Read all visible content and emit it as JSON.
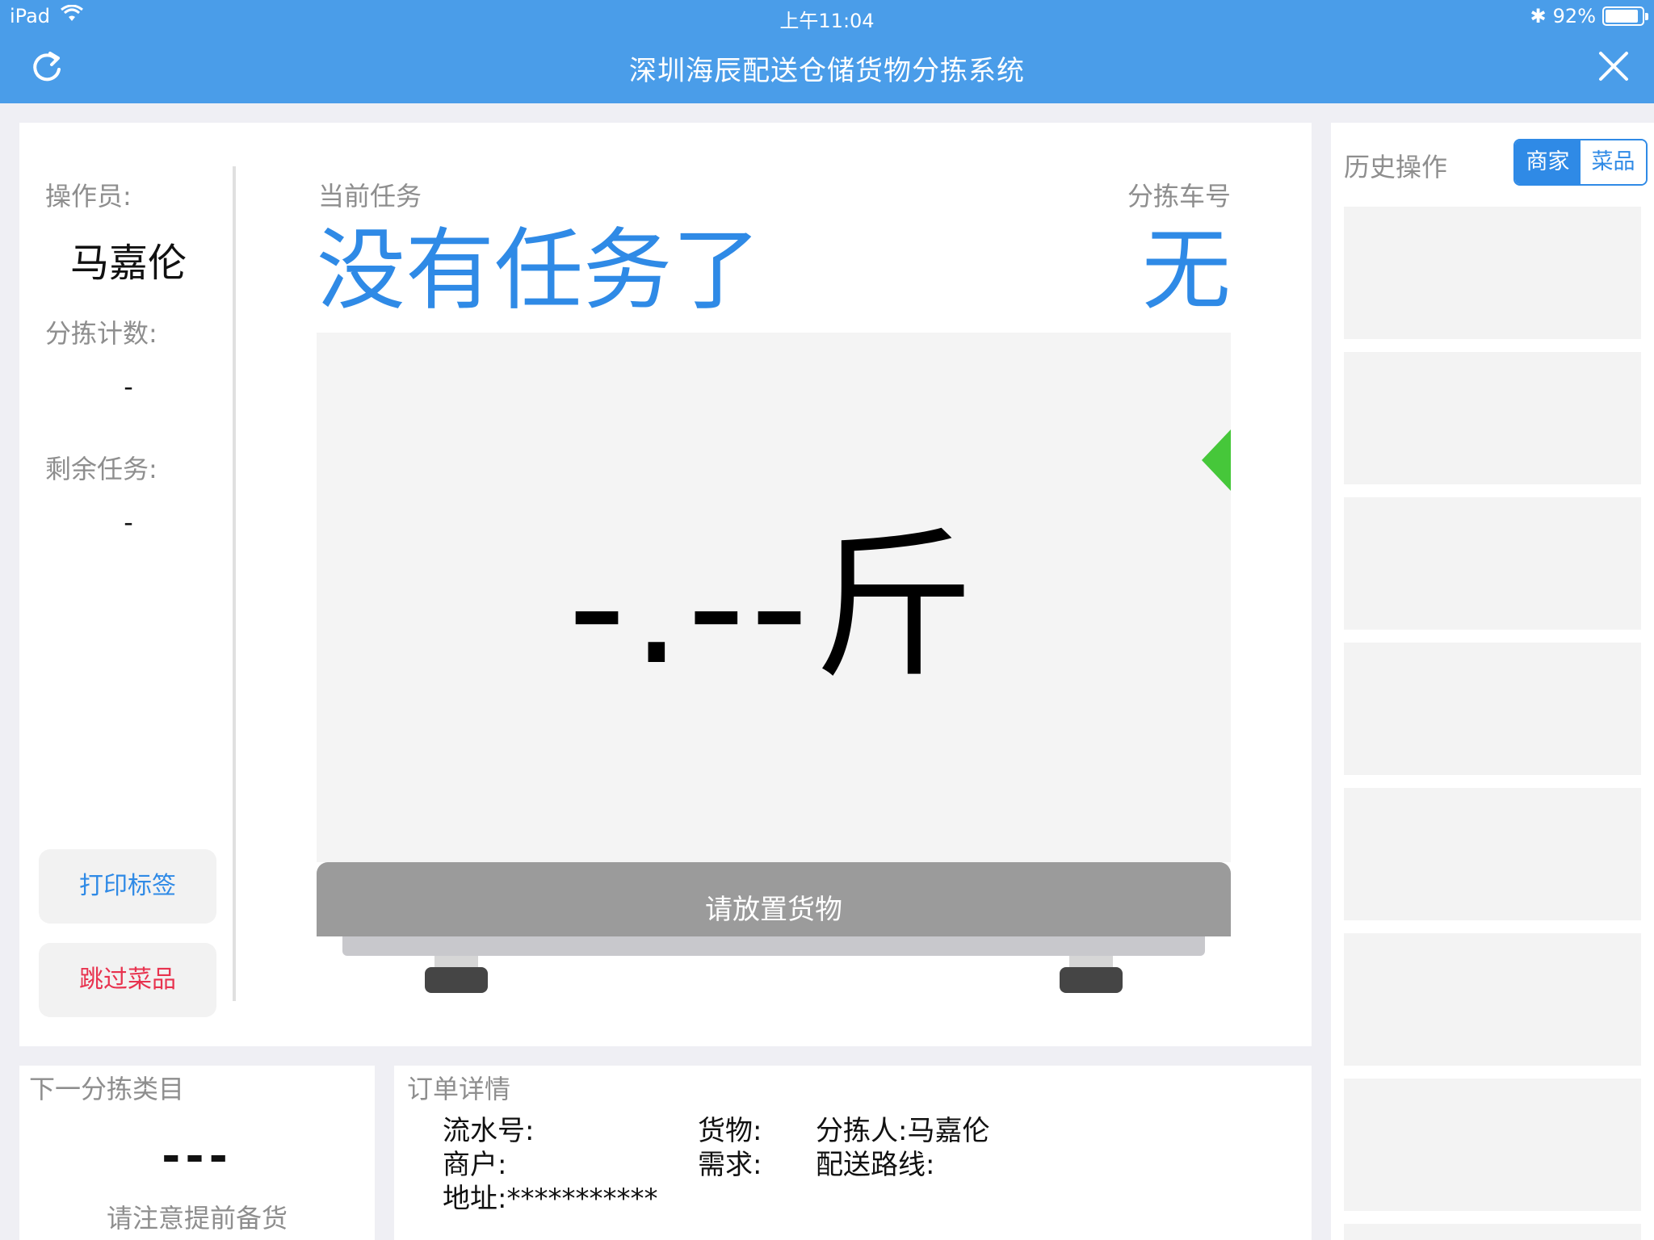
{
  "status_bar": {
    "device": "iPad",
    "time": "上午11:04",
    "battery": "92%",
    "battery_level": 0.92
  },
  "nav": {
    "title": "深圳海辰配送仓储货物分拣系统",
    "refresh_icon": "refresh-icon",
    "close_icon": "close-icon"
  },
  "sidebar": {
    "operator_label": "操作员:",
    "operator_value": "马嘉伦",
    "count_label": "分拣计数:",
    "count_value": "-",
    "remaining_label": "剩余任务:",
    "remaining_value": "-",
    "print_button": "打印标签",
    "skip_button": "跳过菜品"
  },
  "task": {
    "current_label": "当前任务",
    "current_value": "没有任务了",
    "cart_label": "分拣车号",
    "cart_value": "无"
  },
  "scale": {
    "weight": "-.--斤",
    "prompt": "请放置货物"
  },
  "history": {
    "title": "历史操作",
    "segments": [
      "商家",
      "菜品"
    ],
    "selected": "商家"
  },
  "next_category": {
    "title": "下一分拣类目",
    "value": "---",
    "note": "请注意提前备货"
  },
  "order": {
    "title": "订单详情",
    "serial": "流水号:",
    "merchant": "商户:",
    "address": "地址:***********",
    "goods": "货物:",
    "demand": "需求:",
    "sorter": "分拣人:马嘉伦",
    "route": "配送路线:"
  },
  "colors": {
    "header": "#4a9de9",
    "accent": "#2f8ae6",
    "danger": "#e8334f",
    "indicator": "#46c73a"
  }
}
